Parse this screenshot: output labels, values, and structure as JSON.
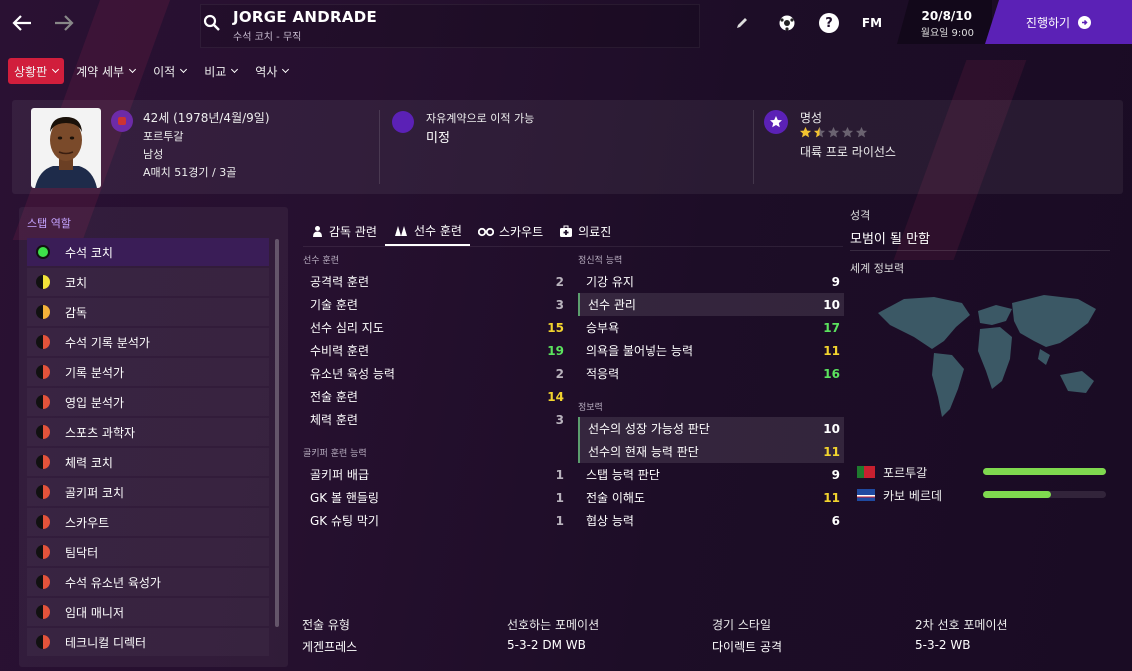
{
  "header": {
    "name": "JORGE ANDRADE",
    "subtitle": "수석 코치 - 무직",
    "date": "20/8/10",
    "day_time": "월요일 9:00",
    "continue_label": "진행하기",
    "fm_label": "FM",
    "help_label": "?"
  },
  "menu": [
    {
      "label": "상황판",
      "active": true
    },
    {
      "label": "계약 세부"
    },
    {
      "label": "이적"
    },
    {
      "label": "비교"
    },
    {
      "label": "역사"
    }
  ],
  "info": {
    "age": "42세 (1978년/4월/9일)",
    "nationality": "포르투갈",
    "gender": "남성",
    "caps": "A매치 51경기 / 3골",
    "transfer_label": "자유계약으로 이적 가능",
    "transfer_value": "미정",
    "rep_label": "명성",
    "rep_stars": 1.5,
    "license": "대륙 프로 라이선스"
  },
  "staff": {
    "title": "스탭 역할",
    "roles": [
      {
        "label": "수석 코치",
        "fit": "green"
      },
      {
        "label": "코치",
        "fit": "half-yellow"
      },
      {
        "label": "감독",
        "fit": "half-orange"
      },
      {
        "label": "수석 기록 분석가",
        "fit": "half-red"
      },
      {
        "label": "기록 분석가",
        "fit": "half-red"
      },
      {
        "label": "영입 분석가",
        "fit": "half-red"
      },
      {
        "label": "스포츠 과학자",
        "fit": "half-red"
      },
      {
        "label": "체력 코치",
        "fit": "half-red"
      },
      {
        "label": "골키퍼 코치",
        "fit": "half-red"
      },
      {
        "label": "스카우트",
        "fit": "half-red"
      },
      {
        "label": "팀닥터",
        "fit": "half-red"
      },
      {
        "label": "수석 유소년 육성가",
        "fit": "half-red"
      },
      {
        "label": "임대 매니저",
        "fit": "half-red"
      },
      {
        "label": "테크니컬 디렉터",
        "fit": "half-red"
      }
    ]
  },
  "tabs": [
    "감독 관련",
    "선수 훈련",
    "스카우트",
    "의료진"
  ],
  "coaching": {
    "title": "선수 훈련",
    "rows": [
      {
        "label": "공격력 훈련",
        "value": "2",
        "c": "gr"
      },
      {
        "label": "기술 훈련",
        "value": "3",
        "c": "gr"
      },
      {
        "label": "선수 심리 지도",
        "value": "15",
        "c": "y"
      },
      {
        "label": "수비력 훈련",
        "value": "19",
        "c": "g"
      },
      {
        "label": "유소년 육성 능력",
        "value": "2",
        "c": "gr"
      },
      {
        "label": "전술 훈련",
        "value": "14",
        "c": "y"
      },
      {
        "label": "체력 훈련",
        "value": "3",
        "c": "gr"
      }
    ]
  },
  "goalkeeping": {
    "title": "골키퍼 훈련 능력",
    "rows": [
      {
        "label": "골키퍼 배급",
        "value": "1",
        "c": "gr"
      },
      {
        "label": "GK 볼 핸들링",
        "value": "1",
        "c": "gr"
      },
      {
        "label": "GK 슈팅 막기",
        "value": "1",
        "c": "gr"
      }
    ]
  },
  "mental": {
    "title": "정신적 능력",
    "rows": [
      {
        "label": "기강 유지",
        "value": "9",
        "c": "w"
      },
      {
        "label": "선수 관리",
        "value": "10",
        "c": "w",
        "hl": true
      },
      {
        "label": "승부욕",
        "value": "17",
        "c": "g"
      },
      {
        "label": "의욕을 불어넣는 능력",
        "value": "11",
        "c": "y"
      },
      {
        "label": "적응력",
        "value": "16",
        "c": "g"
      }
    ]
  },
  "knowledge": {
    "title": "정보력",
    "rows": [
      {
        "label": "선수의 성장 가능성 판단",
        "value": "10",
        "c": "w",
        "hl": true
      },
      {
        "label": "선수의 현재 능력 판단",
        "value": "11",
        "c": "y",
        "hl": true
      },
      {
        "label": "스탭 능력 판단",
        "value": "9",
        "c": "w"
      },
      {
        "label": "전술 이해도",
        "value": "11",
        "c": "y"
      },
      {
        "label": "협상 능력",
        "value": "6",
        "c": "w"
      }
    ]
  },
  "personality": {
    "label": "성격",
    "value": "모범이 될 만함"
  },
  "world": {
    "label": "세계 정보력",
    "nations": [
      {
        "name": "포르투갈",
        "level": 1.0
      },
      {
        "name": "카보 베르데",
        "level": 0.55
      }
    ]
  },
  "bottom": [
    {
      "label": "전술 유형",
      "value": "게겐프레스"
    },
    {
      "label": "선호하는 포메이션",
      "value": "5-3-2 DM WB"
    },
    {
      "label": "경기 스타일",
      "value": "다이렉트 공격"
    },
    {
      "label": "2차 선호 포메이션",
      "value": "5-3-2 WB"
    }
  ],
  "colors": {
    "accent": "#5b21b6",
    "active_menu": "#d11e3c",
    "green": "#5be35e",
    "yellow": "#f2d42e"
  }
}
